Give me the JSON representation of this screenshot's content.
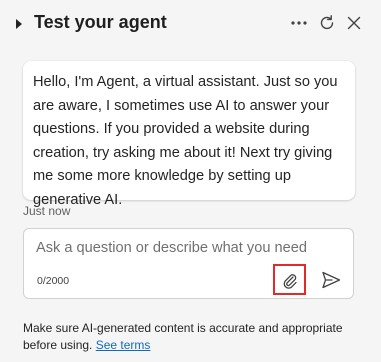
{
  "header": {
    "title": "Test your agent",
    "icons": {
      "expand": "caret-right-icon",
      "more": "more-horizontal-icon",
      "refresh": "refresh-icon",
      "close": "close-icon"
    }
  },
  "message": {
    "text": "Hello, I'm Agent, a virtual assistant. Just so you are aware, I sometimes use AI to answer your questions. If you provided a website during creation, try asking me about it! Next try giving me some more knowledge by setting up generative AI.",
    "timestamp": "Just now"
  },
  "composer": {
    "placeholder": "Ask a question or describe what you need",
    "char_count": "0/2000",
    "icons": {
      "attach": "paperclip-icon",
      "send": "send-icon"
    },
    "highlight_color": "#e02b2b"
  },
  "footer": {
    "disclaimer": "Make sure AI-generated content is accurate and appropriate before using.",
    "terms_link": "See terms"
  },
  "colors": {
    "background": "#f5f5f5",
    "link": "#0f6cbd",
    "bubble": "#ffffff"
  }
}
